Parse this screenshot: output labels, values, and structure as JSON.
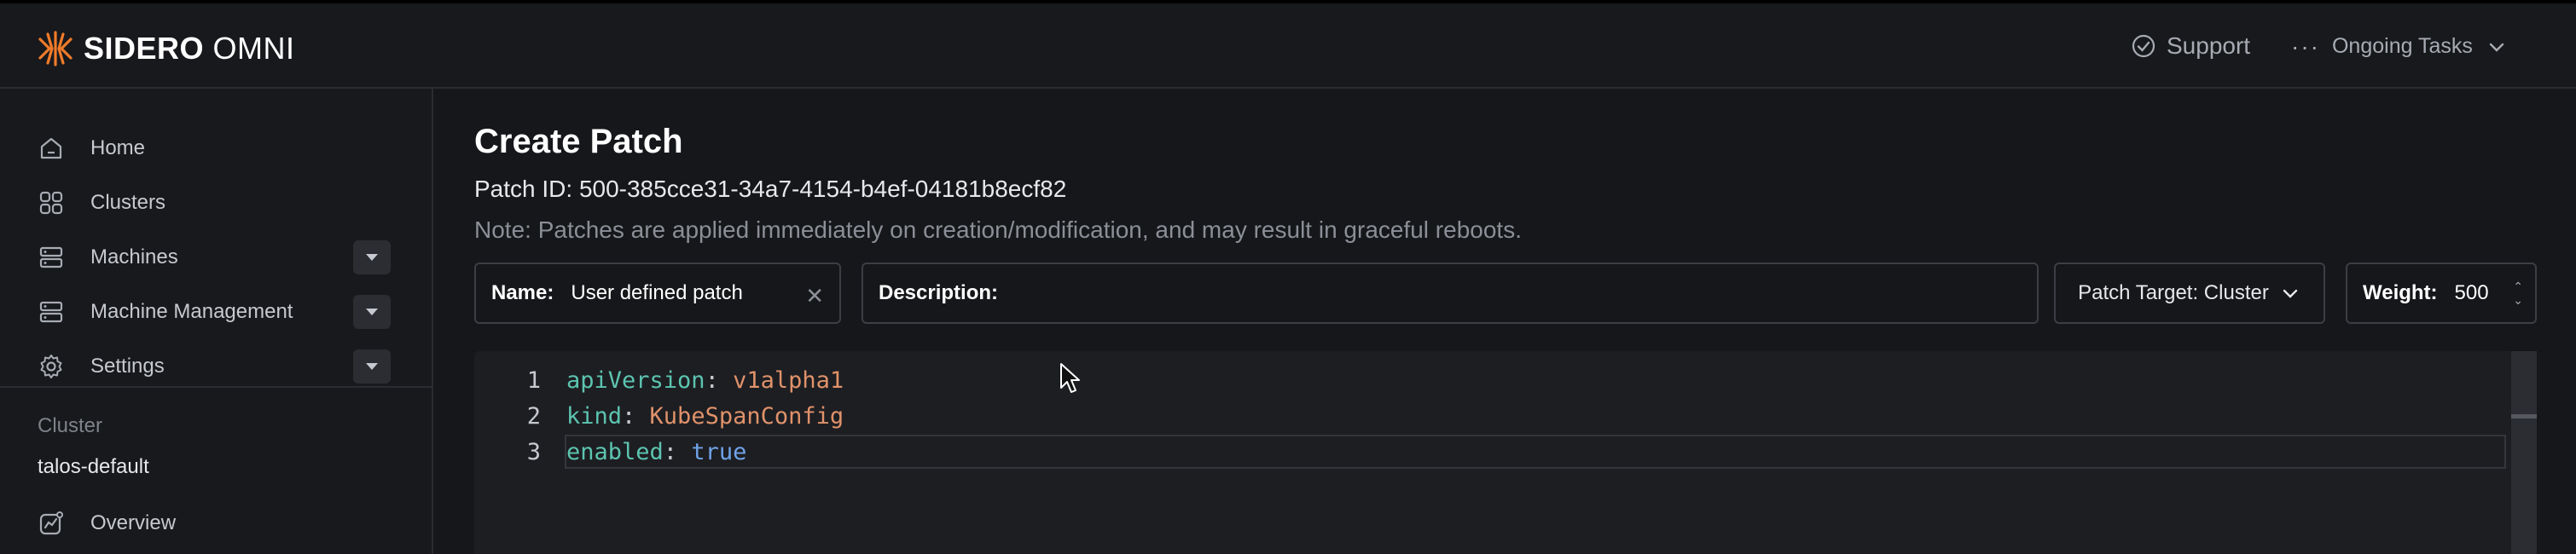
{
  "header": {
    "brand_bold": "SIDERO",
    "brand_light": "OMNI",
    "support_label": "Support",
    "tasks_label": "Ongoing Tasks",
    "accent_color": "#f07b2a"
  },
  "sidebar": {
    "items": [
      {
        "label": "Home",
        "icon": "home-icon"
      },
      {
        "label": "Clusters",
        "icon": "clusters-icon"
      },
      {
        "label": "Machines",
        "icon": "server-icon"
      },
      {
        "label": "Machine Management",
        "icon": "server-icon"
      },
      {
        "label": "Settings",
        "icon": "gear-icon"
      }
    ],
    "cluster_section_label": "Cluster",
    "cluster_name": "talos-default",
    "overview_label": "Overview"
  },
  "main": {
    "title": "Create Patch",
    "patch_id": "Patch ID: 500-385cce31-34a7-4154-b4ef-04181b8ecf82",
    "note": "Note: Patches are applied immediately on creation/modification, and may result in graceful reboots.",
    "name_label": "Name:",
    "name_value": "User defined patch",
    "description_label": "Description:",
    "description_value": "",
    "target_label": "Patch Target: Cluster",
    "weight_label": "Weight:",
    "weight_value": "500"
  },
  "editor": {
    "lines": [
      {
        "num": "1",
        "key": "apiVersion",
        "sep": ": ",
        "value": "v1alpha1"
      },
      {
        "num": "2",
        "key": "kind",
        "sep": ": ",
        "value": "KubeSpanConfig"
      },
      {
        "num": "3",
        "key": "enabled",
        "sep": ": ",
        "value": "true"
      }
    ]
  }
}
